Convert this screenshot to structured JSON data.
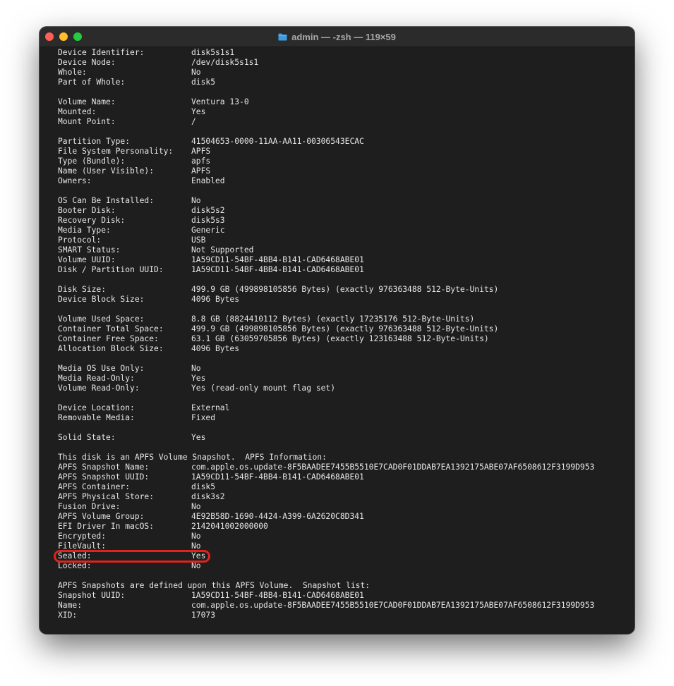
{
  "window": {
    "title": "admin — -zsh — 119×59"
  },
  "terminal": {
    "rows": [
      {
        "line": 2,
        "key": "Device Identifier:",
        "value": "disk5s1s1"
      },
      {
        "line": 3,
        "key": "Device Node:",
        "value": "/dev/disk5s1s1"
      },
      {
        "line": 4,
        "key": "Whole:",
        "value": "No"
      },
      {
        "line": 5,
        "key": "Part of Whole:",
        "value": "disk5"
      },
      {
        "line": 7,
        "key": "Volume Name:",
        "value": "Ventura 13-0"
      },
      {
        "line": 8,
        "key": "Mounted:",
        "value": "Yes"
      },
      {
        "line": 9,
        "key": "Mount Point:",
        "value": "/"
      },
      {
        "line": 11,
        "key": "Partition Type:",
        "value": "41504653-0000-11AA-AA11-00306543ECAC"
      },
      {
        "line": 12,
        "key": "File System Personality:",
        "value": "APFS"
      },
      {
        "line": 13,
        "key": "Type (Bundle):",
        "value": "apfs"
      },
      {
        "line": 14,
        "key": "Name (User Visible):",
        "value": "APFS"
      },
      {
        "line": 15,
        "key": "Owners:",
        "value": "Enabled"
      },
      {
        "line": 17,
        "key": "OS Can Be Installed:",
        "value": "No"
      },
      {
        "line": 18,
        "key": "Booter Disk:",
        "value": "disk5s2"
      },
      {
        "line": 19,
        "key": "Recovery Disk:",
        "value": "disk5s3"
      },
      {
        "line": 20,
        "key": "Media Type:",
        "value": "Generic"
      },
      {
        "line": 21,
        "key": "Protocol:",
        "value": "USB"
      },
      {
        "line": 22,
        "key": "SMART Status:",
        "value": "Not Supported"
      },
      {
        "line": 23,
        "key": "Volume UUID:",
        "value": "1A59CD11-54BF-4BB4-B141-CAD6468ABE01"
      },
      {
        "line": 24,
        "key": "Disk / Partition UUID:",
        "value": "1A59CD11-54BF-4BB4-B141-CAD6468ABE01"
      },
      {
        "line": 26,
        "key": "Disk Size:",
        "value": "499.9 GB (499898105856 Bytes) (exactly 976363488 512-Byte-Units)"
      },
      {
        "line": 27,
        "key": "Device Block Size:",
        "value": "4096 Bytes"
      },
      {
        "line": 29,
        "key": "Volume Used Space:",
        "value": "8.8 GB (8824410112 Bytes) (exactly 17235176 512-Byte-Units)"
      },
      {
        "line": 30,
        "key": "Container Total Space:",
        "value": "499.9 GB (499898105856 Bytes) (exactly 976363488 512-Byte-Units)"
      },
      {
        "line": 31,
        "key": "Container Free Space:",
        "value": "63.1 GB (63059705856 Bytes) (exactly 123163488 512-Byte-Units)"
      },
      {
        "line": 32,
        "key": "Allocation Block Size:",
        "value": "4096 Bytes"
      },
      {
        "line": 34,
        "key": "Media OS Use Only:",
        "value": "No"
      },
      {
        "line": 35,
        "key": "Media Read-Only:",
        "value": "Yes"
      },
      {
        "line": 36,
        "key": "Volume Read-Only:",
        "value": "Yes (read-only mount flag set)"
      },
      {
        "line": 38,
        "key": "Device Location:",
        "value": "External"
      },
      {
        "line": 39,
        "key": "Removable Media:",
        "value": "Fixed"
      },
      {
        "line": 41,
        "key": "Solid State:",
        "value": "Yes"
      },
      {
        "line": 43,
        "text": "This disk is an APFS Volume Snapshot.  APFS Information:"
      },
      {
        "line": 44,
        "key": "APFS Snapshot Name:",
        "value": "com.apple.os.update-8F5BAADEE7455B5510E7CAD0F01DDAB7EA1392175ABE07AF6508612F3199D953"
      },
      {
        "line": 45,
        "key": "APFS Snapshot UUID:",
        "value": "1A59CD11-54BF-4BB4-B141-CAD6468ABE01"
      },
      {
        "line": 46,
        "key": "APFS Container:",
        "value": "disk5"
      },
      {
        "line": 47,
        "key": "APFS Physical Store:",
        "value": "disk3s2"
      },
      {
        "line": 48,
        "key": "Fusion Drive:",
        "value": "No"
      },
      {
        "line": 49,
        "key": "APFS Volume Group:",
        "value": "4E92B58D-1690-4424-A399-6A2620C8D341"
      },
      {
        "line": 50,
        "key": "EFI Driver In macOS:",
        "value": "2142041002000000"
      },
      {
        "line": 51,
        "key": "Encrypted:",
        "value": "No"
      },
      {
        "line": 52,
        "key": "FileVault:",
        "value": "No"
      },
      {
        "line": 53,
        "key": "Sealed:",
        "value": "Yes",
        "highlighted": true
      },
      {
        "line": 54,
        "key": "Locked:",
        "value": "No"
      },
      {
        "line": 56,
        "text": "APFS Snapshots are defined upon this APFS Volume.  Snapshot list:"
      },
      {
        "line": 57,
        "key": "Snapshot UUID:",
        "value": "1A59CD11-54BF-4BB4-B141-CAD6468ABE01"
      },
      {
        "line": 58,
        "key": "Name:",
        "value": "com.apple.os.update-8F5BAADEE7455B5510E7CAD0F01DDAB7EA1392175ABE07AF6508612F3199D953"
      },
      {
        "line": 59,
        "key": "XID:",
        "value": "17073"
      }
    ]
  },
  "colors": {
    "background": "#1e1e1e",
    "text": "#e6e6e6",
    "highlight": "#e2231a"
  }
}
